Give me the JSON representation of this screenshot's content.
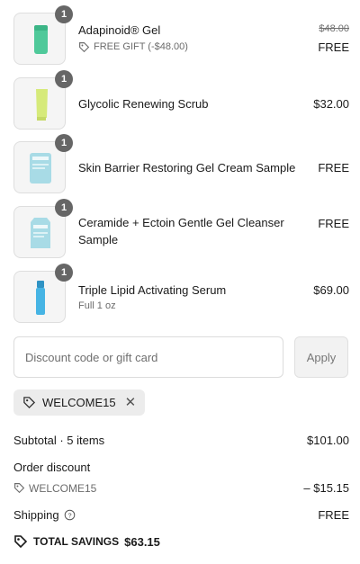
{
  "items": [
    {
      "qty": "1",
      "name": "Adapinoid® Gel",
      "gift_label": "FREE GIFT (-$48.00)",
      "original_price": "$48.00",
      "price": "FREE"
    },
    {
      "qty": "1",
      "name": "Glycolic Renewing Scrub",
      "price": "$32.00"
    },
    {
      "qty": "1",
      "name": "Skin Barrier Restoring Gel Cream Sample",
      "price": "FREE"
    },
    {
      "qty": "1",
      "name_line1": "Ceramide + Ectoin Gentle Gel Cleanser",
      "name_line2": "Sample",
      "price": "FREE"
    },
    {
      "qty": "1",
      "name": "Triple Lipid Activating Serum",
      "variant": "Full 1 oz",
      "price": "$69.00"
    }
  ],
  "discount": {
    "placeholder": "Discount code or gift card",
    "apply_label": "Apply",
    "applied_code": "WELCOME15"
  },
  "summary": {
    "subtotal_label": "Subtotal · 5 items",
    "subtotal_value": "$101.00",
    "order_discount_label": "Order discount",
    "discount_code": "WELCOME15",
    "discount_value": "– $15.15",
    "shipping_label": "Shipping",
    "shipping_value": "FREE",
    "total_savings_label": "TOTAL SAVINGS",
    "total_savings_value": "$63.15"
  },
  "colors": {
    "badge": "#666666",
    "tube_green": "#4fc99a",
    "tube_lime": "#d6ea7a",
    "sachet_blue": "#a8dbe6",
    "serum_blue": "#46b4e4"
  }
}
